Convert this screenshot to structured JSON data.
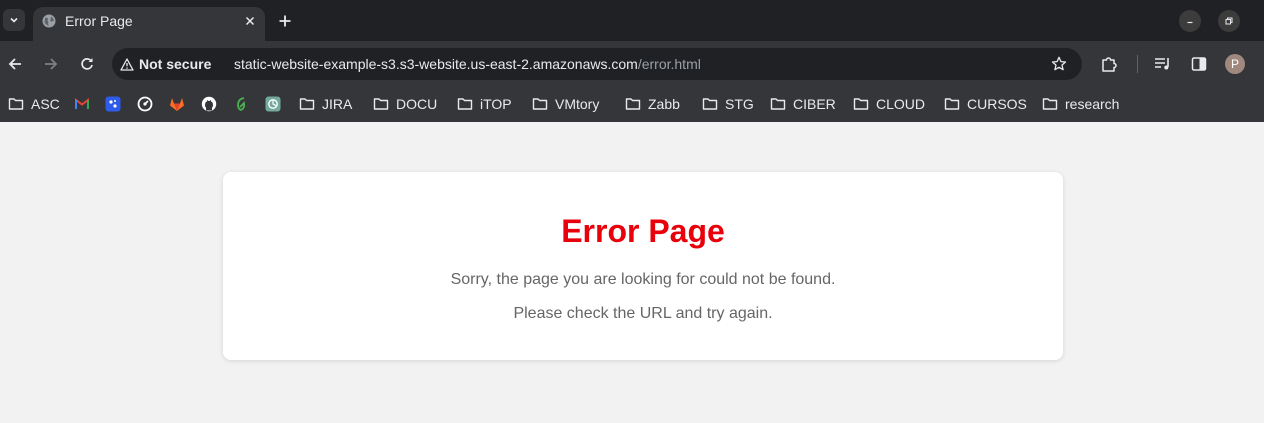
{
  "browser": {
    "tab": {
      "title": "Error Page"
    },
    "address_bar": {
      "security_label": "Not secure",
      "url_host": "static-website-example-s3.s3-website.us-east-2.amazonaws.com",
      "url_path": "/error.html"
    },
    "profile": {
      "initial": "P"
    },
    "bookmarks": {
      "asc": "ASC",
      "jira": "JIRA",
      "docu": "DOCU",
      "itop": "iTOP",
      "vmtory": "VMtory",
      "zabb": "Zabb",
      "stg": "STG",
      "ciber": "CIBER",
      "cloud": "CLOUD",
      "cursos": "CURSOS",
      "research": "research"
    }
  },
  "page": {
    "title": "Error Page",
    "message": "Sorry, the page you are looking for could not be found.",
    "hint": "Please check the URL and try again."
  },
  "colors": {
    "error_red": "#e8000b",
    "text_gray": "#666666",
    "page_bg": "#f2f2f2",
    "chrome_dark": "#202124",
    "chrome_toolbar": "#35363a"
  }
}
